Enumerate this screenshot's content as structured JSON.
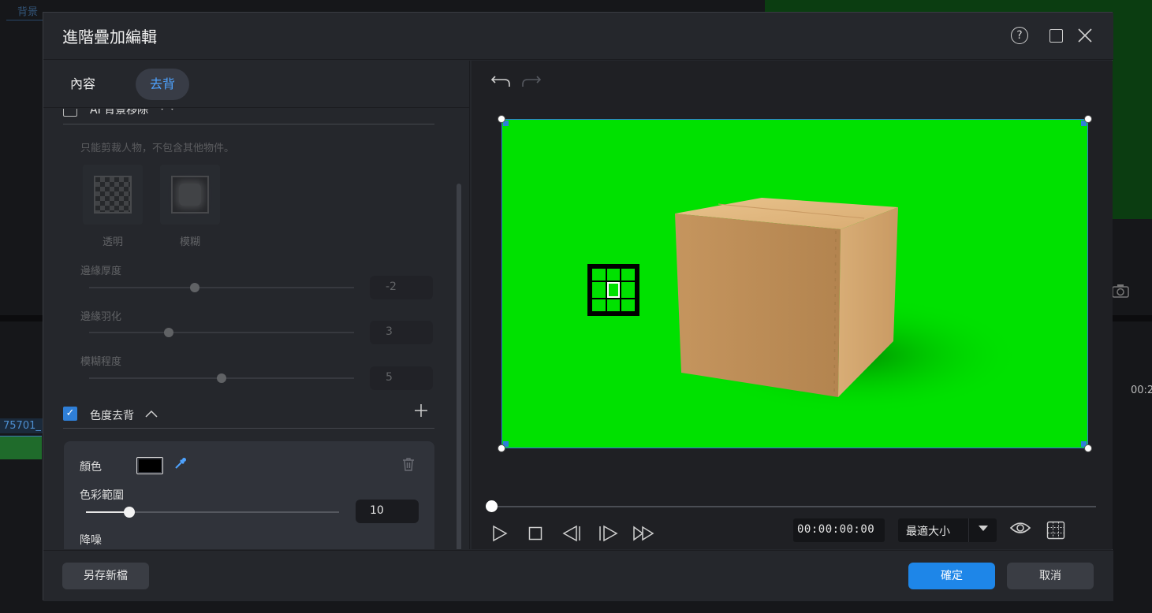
{
  "background": {
    "tab_label": "背景",
    "clip_label": "75701_",
    "time_label": "00:2"
  },
  "dialog": {
    "title": "進階疊加編輯",
    "help_symbol": "?"
  },
  "tabs": [
    {
      "label": "內容"
    },
    {
      "label": "去背"
    }
  ],
  "ai_removal": {
    "label": "AI 背景移除",
    "hint": "只能剪裁人物，不包含其他物件。",
    "options": [
      {
        "label": "透明"
      },
      {
        "label": "模糊"
      }
    ],
    "sliders": [
      {
        "label": "邊緣厚度",
        "value": "-2",
        "level": 0.4
      },
      {
        "label": "邊緣羽化",
        "value": "3",
        "level": 0.3
      },
      {
        "label": "模糊程度",
        "value": "5",
        "level": 0.5
      }
    ]
  },
  "chroma_key": {
    "label": "色度去背",
    "checked": true,
    "color_label": "顏色",
    "color_value": "#000000",
    "range_label": "色彩範圍",
    "range_value": "10",
    "range_level": 0.17,
    "noise_label": "降噪"
  },
  "preview": {
    "background_color": "#00e100",
    "subject": "cardboard box"
  },
  "player": {
    "timecode": "00:00:00:00",
    "zoom_label": "最適大小",
    "position": 0
  },
  "footer": {
    "save_new_label": "另存新檔",
    "ok_label": "確定",
    "cancel_label": "取消"
  },
  "colors": {
    "accent": "#1e86e8",
    "chroma_green": "#00e100"
  }
}
